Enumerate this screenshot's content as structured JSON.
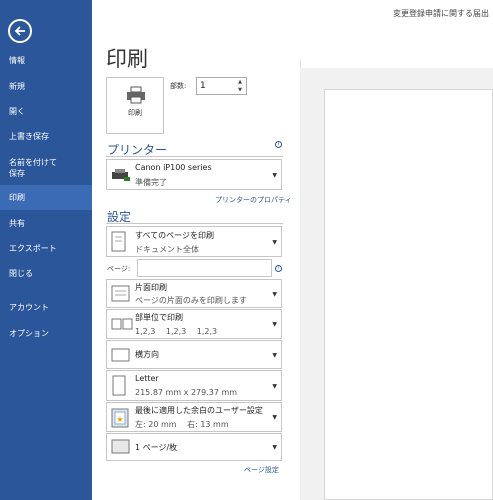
{
  "window": {
    "document_title": "変更登録申請に関する届出"
  },
  "sidebar": {
    "items": [
      {
        "label": "情報"
      },
      {
        "label": "新規"
      },
      {
        "label": "開く"
      },
      {
        "label": "上書き保存"
      },
      {
        "label": "名前を付けて"
      },
      {
        "label": "保存"
      },
      {
        "label": "印刷"
      },
      {
        "label": "共有"
      },
      {
        "label": "エクスポート"
      },
      {
        "label": "閉じる"
      },
      {
        "label": "アカウント"
      },
      {
        "label": "オプション"
      }
    ]
  },
  "main": {
    "title": "印刷",
    "print_button": "印刷",
    "copies_label": "部数:",
    "copies_value": "1"
  },
  "printer": {
    "heading": "プリンター",
    "name": "Canon iP100 series",
    "status": "準備完了",
    "properties_link": "プリンターのプロパティ"
  },
  "settings": {
    "heading": "設定",
    "pages_label": "ページ:",
    "pages_value": "",
    "items": [
      {
        "line1": "すべてのページを印刷",
        "line2": "ドキュメント全体"
      },
      {
        "line1": "片面印刷",
        "line2": "ページの片面のみを印刷します"
      },
      {
        "line1": "部単位で印刷",
        "line2": "1,2,3　 1,2,3　 1,2,3"
      },
      {
        "line1": "横方向",
        "line2": ""
      },
      {
        "line1": "Letter",
        "line2": "215.87 mm x 279.37 mm"
      },
      {
        "line1": "最後に適用した余白のユーザー設定",
        "line2": "左:  20 mm　 右:  13 mm"
      },
      {
        "line1": "1 ページ/枚",
        "line2": ""
      }
    ],
    "page_setup_link": "ページ設定"
  },
  "colors": {
    "sidebar": "#2b579a",
    "active": "#3c6bb5",
    "accent": "#2b579a"
  }
}
